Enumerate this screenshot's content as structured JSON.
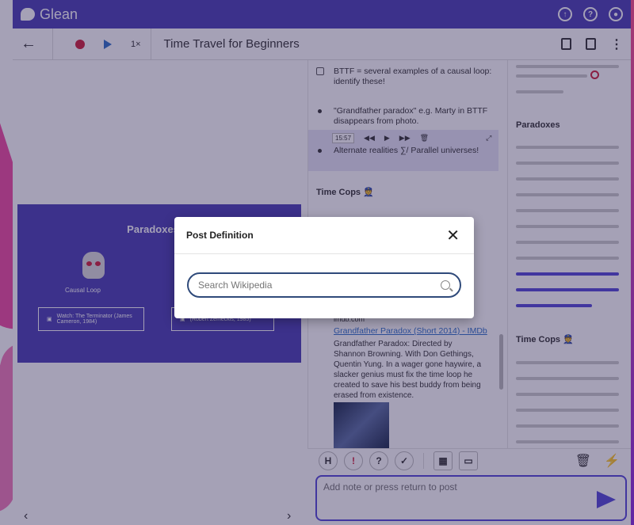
{
  "app": {
    "name": "Glean"
  },
  "toolbar": {
    "back_icon": "arrow-left-icon",
    "speed": "1×",
    "title": "Time Travel for Beginners"
  },
  "slide": {
    "title": "Paradoxes to",
    "causal_label": "Causal Loop",
    "watch1": "Watch: The Terminator (James Cameron, 1984)",
    "watch2": "(Robert Zemeckis, 1985)"
  },
  "notes": [
    {
      "text": "BTTF = several examples of a causal loop: identify these!"
    },
    {
      "text": "\"Grandfather paradox\" e.g. Marty in BTTF disappears from photo."
    },
    {
      "text": "Alternate realities ∑/ Parallel universes!"
    }
  ],
  "player": {
    "timestamp": "15:57"
  },
  "section_time_cops": "Time Cops 👮",
  "imdb": {
    "host": "imdb.com",
    "link": "Grandfather Paradox (Short 2014) - IMDb",
    "desc": "Grandfather Paradox: Directed by Shannon Browning. With Don Gethings, Quentin Yung. In a wager gone haywire, a slacker genius must fix the time loop he created to save his best buddy from being erased from existence."
  },
  "outline": {
    "paradoxes": "Paradoxes",
    "time_cops": "Time Cops 👮"
  },
  "composer": {
    "placeholder": "Add note or press return to post"
  },
  "modal": {
    "title": "Post Definition",
    "search_placeholder": "Search Wikipedia"
  },
  "bottombar": {
    "heading_label": "H"
  }
}
